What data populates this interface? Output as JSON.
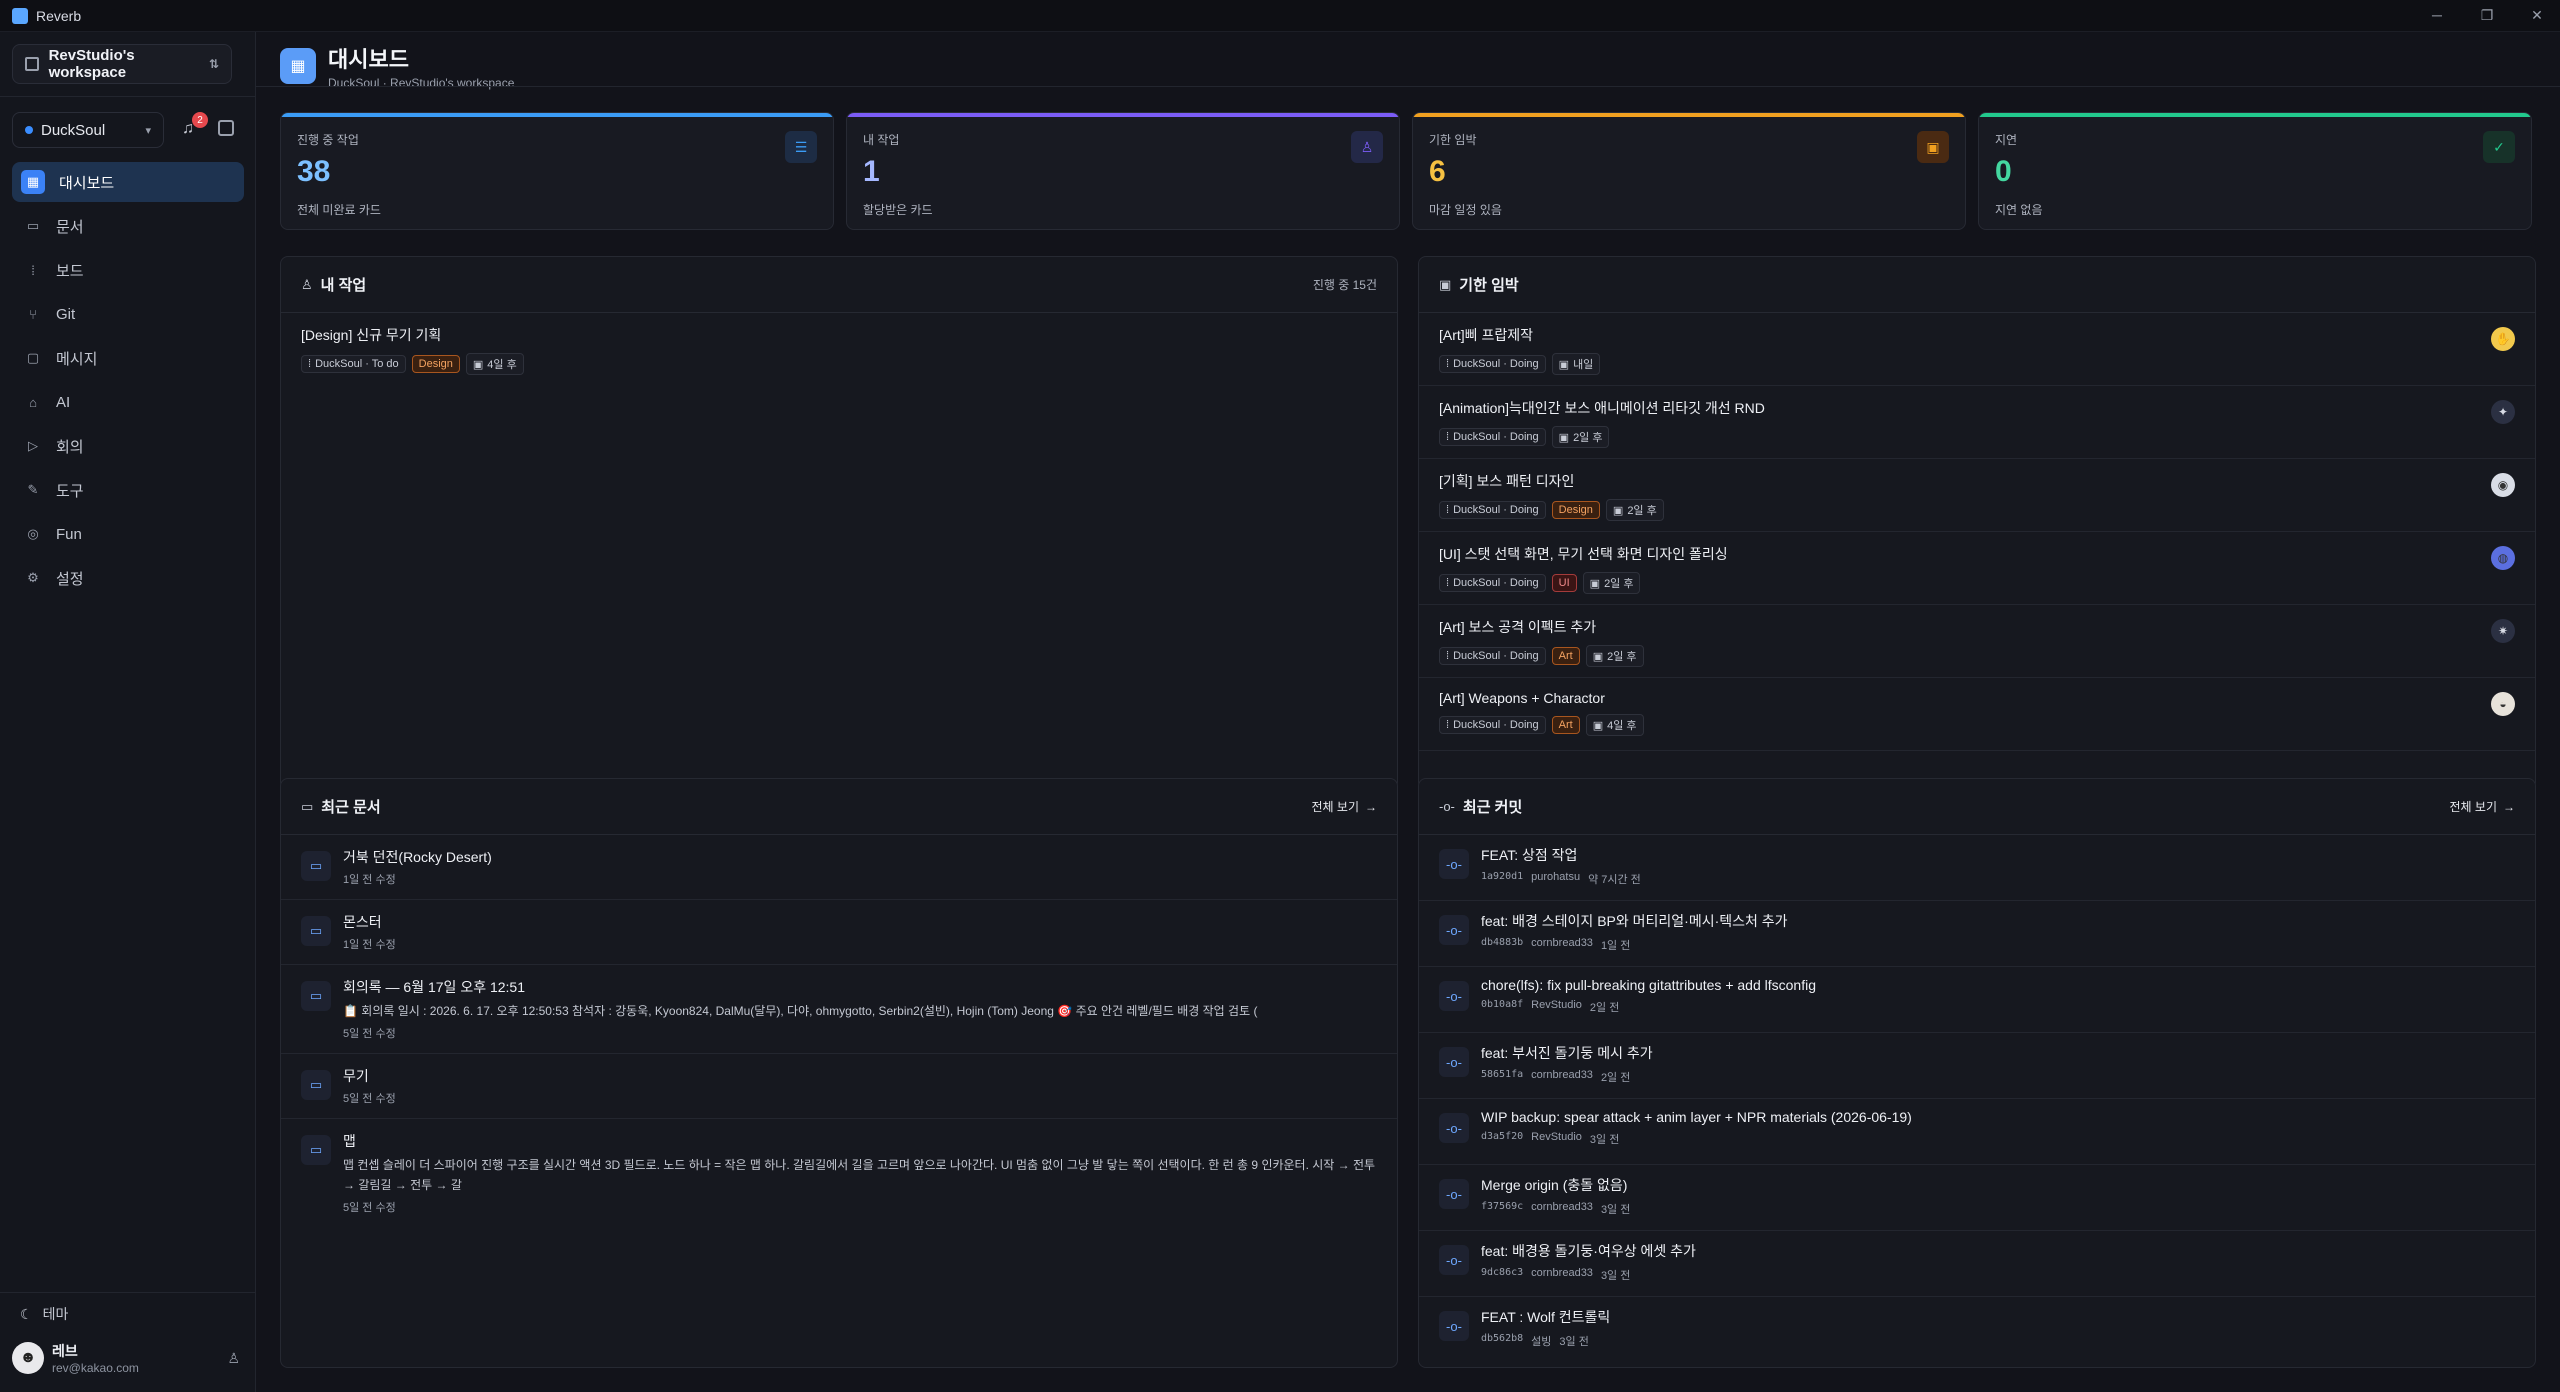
{
  "window": {
    "app_title": "Reverb",
    "controls": [
      "─",
      "❐",
      "✕"
    ]
  },
  "sidebar": {
    "workspace": "RevStudio's workspace",
    "project": "DuckSoul",
    "notification_count": "2",
    "nav": [
      {
        "label": "대시보드",
        "icon": "grid-icon",
        "glyph": "▦",
        "active": true
      },
      {
        "label": "문서",
        "icon": "book-icon",
        "glyph": "▭"
      },
      {
        "label": "보드",
        "icon": "board-icon",
        "glyph": "⁞"
      },
      {
        "label": "Git",
        "icon": "git-branch-icon",
        "glyph": "⑂"
      },
      {
        "label": "메시지",
        "icon": "message-icon",
        "glyph": "▢"
      },
      {
        "label": "AI",
        "icon": "bot-icon",
        "glyph": "⌂"
      },
      {
        "label": "회의",
        "icon": "video-icon",
        "glyph": "▷"
      },
      {
        "label": "도구",
        "icon": "wrench-icon",
        "glyph": "✎"
      },
      {
        "label": "Fun",
        "icon": "gamepad-icon",
        "glyph": "◎"
      },
      {
        "label": "설정",
        "icon": "settings-icon",
        "glyph": "⚙"
      }
    ],
    "theme_label": "테마",
    "user": {
      "name": "레브",
      "email": "rev@kakao.com"
    }
  },
  "header": {
    "title": "대시보드",
    "subtitle": "DuckSoul · RevStudio's workspace"
  },
  "stats": [
    {
      "label": "진행 중 작업",
      "value": "38",
      "sub": "전체 미완료 카드",
      "color": "#3b9cf6",
      "value_color": "#7cc0ff",
      "icon": "list-check-icon",
      "glyph": "☰",
      "icon_bg": "#1d2c44"
    },
    {
      "label": "내 작업",
      "value": "1",
      "sub": "할당받은 카드",
      "color": "#7b5cf6",
      "value_color": "#a5b8ff",
      "icon": "user-icon",
      "glyph": "♙",
      "icon_bg": "#232847"
    },
    {
      "label": "기한 임박",
      "value": "6",
      "sub": "마감 일정 있음",
      "color": "#f0a020",
      "value_color": "#f6c142",
      "icon": "calendar-icon",
      "glyph": "▣",
      "icon_bg": "#4a2a12"
    },
    {
      "label": "지연",
      "value": "0",
      "sub": "지연 없음",
      "color": "#22c98d",
      "value_color": "#44d7a0",
      "icon": "check-circle-icon",
      "glyph": "✓",
      "icon_bg": "#173229"
    }
  ],
  "my_tasks": {
    "title": "내 작업",
    "count": "진행 중 15건",
    "items": [
      {
        "title": "[Design] 신규 무기 기획",
        "board": "DuckSoul · To do",
        "tag": "Design",
        "due": "4일 후"
      }
    ]
  },
  "deadlines": {
    "title": "기한 임박",
    "items": [
      {
        "title": "[Art]삐 프랍제작",
        "board": "DuckSoul · Doing",
        "tag": "",
        "due": "내일",
        "avatar": "#f2c94c",
        "glyph": "✋"
      },
      {
        "title": "[Animation]늑대인간 보스 애니메이션 리타깃 개선 RND",
        "board": "DuckSoul · Doing",
        "tag": "",
        "due": "2일 후",
        "avatar": "#2b3042",
        "glyph": "✦"
      },
      {
        "title": "[기획] 보스 패턴 디자인",
        "board": "DuckSoul · Doing",
        "tag": "Design",
        "due": "2일 후",
        "avatar": "#d9dde6",
        "glyph": "◉"
      },
      {
        "title": "[UI] 스탯 선택 화면, 무기 선택 화면 디자인 폴리싱",
        "board": "DuckSoul · Doing",
        "tag": "UI",
        "due": "2일 후",
        "avatar": "#5b6fe0",
        "glyph": "◍"
      },
      {
        "title": "[Art] 보스 공격 이펙트 추가",
        "board": "DuckSoul · Doing",
        "tag": "Art",
        "due": "2일 후",
        "avatar": "#2b3042",
        "glyph": "✷"
      },
      {
        "title": "[Art] Weapons + Charactor",
        "board": "DuckSoul · Doing",
        "tag": "Art",
        "due": "4일 후",
        "avatar": "#e7e2da",
        "glyph": "◒"
      }
    ]
  },
  "recent_docs": {
    "title": "최근 문서",
    "view_all": "전체 보기",
    "items": [
      {
        "title": "거북 던전(Rocky Desert)",
        "snippet": "",
        "time": "1일 전 수정"
      },
      {
        "title": "몬스터",
        "snippet": "",
        "time": "1일 전 수정"
      },
      {
        "title": "회의록 — 6월 17일 오후 12:51",
        "snippet": "📋 회의록 일시 : 2026. 6. 17. 오후 12:50:53 참석자 : 강동욱, Kyoon824, DalMu(달무), 다야, ohmygotto, Serbin2(설빈), Hojin (Tom) Jeong 🎯 주요 안건 레벨/필드 배경 작업 검토 (",
        "time": "5일 전 수정"
      },
      {
        "title": "무기",
        "snippet": "",
        "time": "5일 전 수정"
      },
      {
        "title": "맵",
        "snippet": "맵 컨셉 슬레이 더 스파이어 진행 구조를 실시간 액션 3D 필드로. 노드 하나 = 작은 맵 하나. 갈림길에서 길을 고르며 앞으로 나아간다. UI 멈춤 없이 그냥 발 닿는 쪽이 선택이다. 한 런 총 9 인카운터. 시작 → 전투 → 갈림길 → 전투 → 갈",
        "time": "5일 전 수정"
      }
    ]
  },
  "recent_commits": {
    "title": "최근 커밋",
    "view_all": "전체 보기",
    "items": [
      {
        "msg": "FEAT: 상점 작업",
        "hash": "1a920d1",
        "author": "purohatsu",
        "time": "약 7시간 전"
      },
      {
        "msg": "feat: 배경 스테이지 BP와 머티리얼·메시·텍스처 추가",
        "hash": "db4883b",
        "author": "cornbread33",
        "time": "1일 전"
      },
      {
        "msg": "chore(lfs): fix pull-breaking gitattributes + add lfsconfig",
        "hash": "0b10a8f",
        "author": "RevStudio",
        "time": "2일 전"
      },
      {
        "msg": "feat: 부서진 돌기둥 메시 추가",
        "hash": "58651fa",
        "author": "cornbread33",
        "time": "2일 전"
      },
      {
        "msg": "WIP backup: spear attack + anim layer + NPR materials (2026-06-19)",
        "hash": "d3a5f20",
        "author": "RevStudio",
        "time": "3일 전"
      },
      {
        "msg": "Merge origin (충돌 없음)",
        "hash": "f37569c",
        "author": "cornbread33",
        "time": "3일 전"
      },
      {
        "msg": "feat: 배경용 돌기둥·여우상 에셋 추가",
        "hash": "9dc86c3",
        "author": "cornbread33",
        "time": "3일 전"
      },
      {
        "msg": "FEAT : Wolf 컨트롤릭",
        "hash": "db562b8",
        "author": "설빙",
        "time": "3일 전"
      }
    ]
  },
  "tag_colors": {
    "Design": {
      "bg": "#3a2010",
      "border": "#a8561f",
      "fg": "#f4a261"
    },
    "UI": {
      "bg": "#3a1414",
      "border": "#a33b3b",
      "fg": "#f08a8a"
    },
    "Art": {
      "bg": "#3a2010",
      "border": "#a8561f",
      "fg": "#f4a261"
    }
  }
}
